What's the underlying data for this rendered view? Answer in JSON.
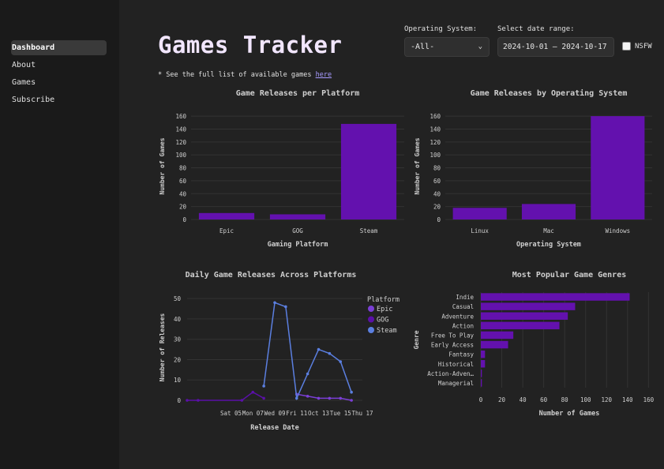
{
  "sidebar": {
    "items": [
      {
        "label": "Dashboard",
        "active": true
      },
      {
        "label": "About"
      },
      {
        "label": "Games"
      },
      {
        "label": "Subscribe"
      }
    ]
  },
  "header": {
    "title": "Games Tracker",
    "note_prefix": "* See the full list of available games ",
    "note_link": "here"
  },
  "filters": {
    "os_label": "Operating System:",
    "os_value": "-All-",
    "date_label": "Select date range:",
    "date_value": "2024-10-01 – 2024-10-17",
    "nsfw_label": "NSFW",
    "nsfw_checked": false
  },
  "colors": {
    "bar": "#6311ae",
    "epic": "#7b3fd6",
    "gog": "#5a10a8",
    "steam": "#5b7fe0"
  },
  "chart_data": [
    {
      "type": "bar",
      "title": "Game Releases per Platform",
      "xlabel": "Gaming Platform",
      "ylabel": "Number of Games",
      "categories": [
        "Epic",
        "GOG",
        "Steam"
      ],
      "values": [
        10,
        8,
        148
      ],
      "ylim": [
        0,
        165
      ],
      "yticks": [
        0,
        20,
        40,
        60,
        80,
        100,
        120,
        140,
        160
      ]
    },
    {
      "type": "bar",
      "title": "Game Releases by Operating System",
      "xlabel": "Operating System",
      "ylabel": "Number of Games",
      "categories": [
        "Linux",
        "Mac",
        "Windows"
      ],
      "values": [
        18,
        24,
        160
      ],
      "ylim": [
        0,
        165
      ],
      "yticks": [
        0,
        20,
        40,
        60,
        80,
        100,
        120,
        140,
        160
      ]
    },
    {
      "type": "line",
      "title": "Daily Game Releases Across Platforms",
      "xlabel": "Release Date",
      "ylabel": "Number of Releases",
      "legend_title": "Platform",
      "xlim": [
        "2024-10-01",
        "2024-10-17"
      ],
      "xticks": [
        "Sat 05",
        "Mon 07",
        "Wed 09",
        "Fri 11",
        "Oct 13",
        "Tue 15",
        "Thu 17"
      ],
      "xtick_dates": [
        "2024-10-05",
        "2024-10-07",
        "2024-10-09",
        "2024-10-11",
        "2024-10-13",
        "2024-10-15",
        "2024-10-17"
      ],
      "ylim": [
        0,
        52
      ],
      "yticks": [
        0,
        10,
        20,
        30,
        40,
        50
      ],
      "series": [
        {
          "name": "Epic",
          "points": [
            [
              "2024-10-11",
              3
            ],
            [
              "2024-10-12",
              2
            ],
            [
              "2024-10-13",
              1
            ],
            [
              "2024-10-14",
              1
            ],
            [
              "2024-10-15",
              1
            ],
            [
              "2024-10-16",
              0
            ]
          ]
        },
        {
          "name": "GOG",
          "points": [
            [
              "2024-10-01",
              0
            ],
            [
              "2024-10-02",
              0
            ],
            [
              "2024-10-06",
              0
            ],
            [
              "2024-10-07",
              4
            ],
            [
              "2024-10-08",
              1
            ]
          ]
        },
        {
          "name": "Steam",
          "points": [
            [
              "2024-10-08",
              7
            ],
            [
              "2024-10-09",
              48
            ],
            [
              "2024-10-10",
              46
            ],
            [
              "2024-10-11",
              1
            ],
            [
              "2024-10-12",
              13
            ],
            [
              "2024-10-13",
              25
            ],
            [
              "2024-10-14",
              23
            ],
            [
              "2024-10-15",
              19
            ],
            [
              "2024-10-16",
              4
            ]
          ]
        }
      ]
    },
    {
      "type": "bar",
      "orientation": "horizontal",
      "title": "Most Popular Game Genres",
      "xlabel": "Number of Games",
      "ylabel": "Genre",
      "categories": [
        "Indie",
        "Casual",
        "Adventure",
        "Action",
        "Free To Play",
        "Early Access",
        "Fantasy",
        "Historical",
        "Action-Adven…",
        "Managerial"
      ],
      "values": [
        142,
        90,
        83,
        75,
        31,
        26,
        4,
        4,
        1,
        1
      ],
      "xlim": [
        0,
        165
      ],
      "xticks": [
        0,
        20,
        40,
        60,
        80,
        100,
        120,
        140,
        160
      ]
    }
  ]
}
